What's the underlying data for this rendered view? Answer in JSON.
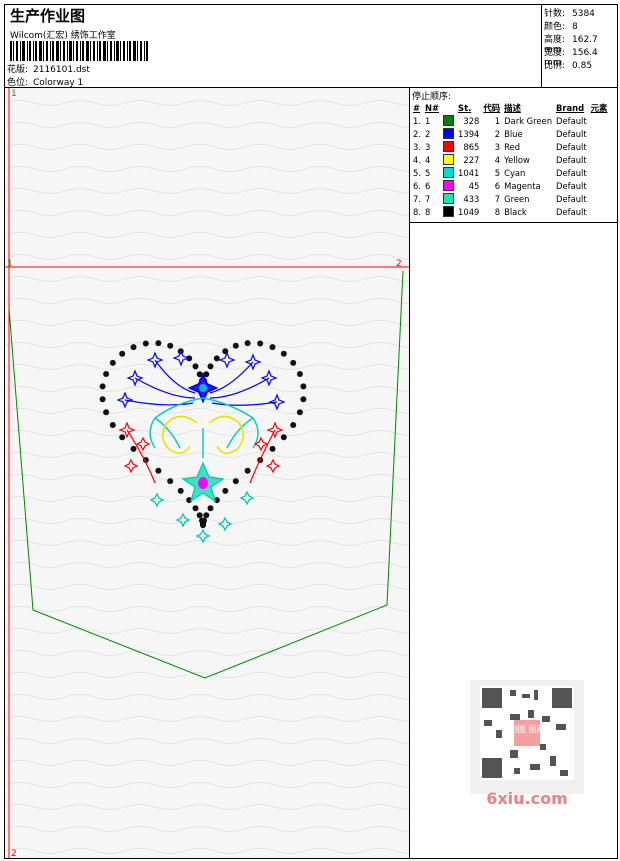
{
  "header": {
    "title": "生产作业图",
    "subtitle": "Wilcom(汇宏) 绣饰工作室",
    "design_label": "花版:",
    "design_value": "2116101.dst",
    "colorway_label": "色位:",
    "colorway_value": "Colorway 1"
  },
  "stats": [
    {
      "label": "针数:",
      "value": "5384"
    },
    {
      "label": "颜色:",
      "value": "8"
    },
    {
      "label": "高度:",
      "value": "162.7 mm"
    },
    {
      "label": "宽度:",
      "value": "156.4 mm"
    },
    {
      "label": "比例:",
      "value": "0.85"
    }
  ],
  "panel": {
    "title": "停止顺序:",
    "headers": [
      "#",
      "N#",
      "St.",
      "代码",
      "描述",
      "Brand",
      "元素"
    ],
    "rows": [
      {
        "idx": "1.",
        "n": "1",
        "color": "#008000",
        "st": "328",
        "code": "1",
        "desc": "Dark Green",
        "brand": "Default"
      },
      {
        "idx": "2.",
        "n": "2",
        "color": "#0000ff",
        "st": "1394",
        "code": "2",
        "desc": "Blue",
        "brand": "Default"
      },
      {
        "idx": "3.",
        "n": "3",
        "color": "#ff0000",
        "st": "865",
        "code": "3",
        "desc": "Red",
        "brand": "Default"
      },
      {
        "idx": "4.",
        "n": "4",
        "color": "#ffff00",
        "st": "227",
        "code": "4",
        "desc": "Yellow",
        "brand": "Default"
      },
      {
        "idx": "5.",
        "n": "5",
        "color": "#00e0c0",
        "st": "1041",
        "code": "5",
        "desc": "Cyan",
        "brand": "Default"
      },
      {
        "idx": "6.",
        "n": "6",
        "color": "#ff00ff",
        "st": "45",
        "code": "6",
        "desc": "Magenta",
        "brand": "Default"
      },
      {
        "idx": "7.",
        "n": "7",
        "color": "#20e0b0",
        "st": "433",
        "code": "7",
        "desc": "Green",
        "brand": "Default"
      },
      {
        "idx": "8.",
        "n": "8",
        "color": "#000000",
        "st": "1049",
        "code": "8",
        "desc": "Black",
        "brand": "Default"
      }
    ]
  },
  "canvas": {
    "marker_top_left": "1",
    "marker_mid_left": "1",
    "marker_mid_right": "2",
    "marker_bottom_left": "2"
  },
  "watermark": {
    "text": "6xiu.com",
    "seal": "刻图 图网"
  }
}
